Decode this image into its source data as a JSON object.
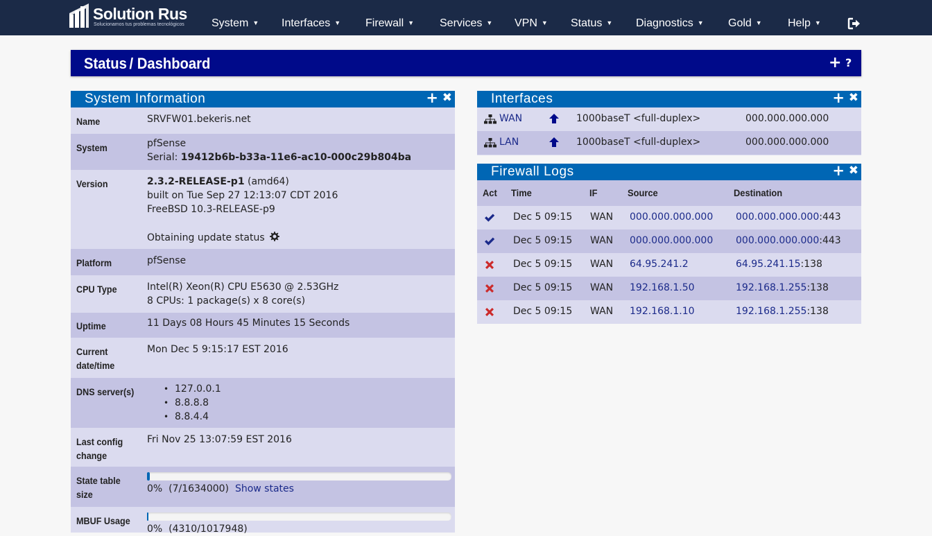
{
  "brand": {
    "name": "Solution Rus",
    "tagline": "Solucionamos tus problemas tecnológicos"
  },
  "nav": {
    "items": [
      "System",
      "Interfaces",
      "Firewall",
      "Services",
      "VPN",
      "Status",
      "Diagnostics",
      "Gold",
      "Help"
    ],
    "logout_icon": "sign-out-icon"
  },
  "header": {
    "section": "Status",
    "separator": "/",
    "page": "Dashboard",
    "add": "+",
    "help": "?"
  },
  "system_info": {
    "title": "System Information",
    "name_label": "Name",
    "name_value": "SRVFW01.bekeris.net",
    "system_label": "System",
    "system_line1": "pfSense",
    "serial_prefix": "Serial: ",
    "serial": "19412b6b-b33a-11e6-ac10-000c29b804ba",
    "version_label": "Version",
    "version": "2.3.2-RELEASE-p1",
    "arch": " (amd64)",
    "built": "built on Tue Sep 27 12:13:07 CDT 2016",
    "freebsd": "FreeBSD 10.3-RELEASE-p9",
    "update_status": "Obtaining update status",
    "platform_label": "Platform",
    "platform": "pfSense",
    "cpu_label": "CPU Type",
    "cpu_line1": "Intel(R) Xeon(R) CPU E5630 @ 2.53GHz",
    "cpu_line2": "8 CPUs: 1 package(s) x 8 core(s)",
    "uptime_label": "Uptime",
    "uptime": "11 Days 08 Hours 45 Minutes 15 Seconds",
    "datetime_label1": "Current",
    "datetime_label2": "date/time",
    "datetime": "Mon Dec 5 9:15:17 EST 2016",
    "dns_label": "DNS server(s)",
    "dns": [
      "127.0.0.1",
      "8.8.8.8",
      "8.8.4.4"
    ],
    "config_label1": "Last config",
    "config_label2": "change",
    "config": "Fri Nov 25 13:07:59 EST 2016",
    "state_label1": "State table",
    "state_label2": "size",
    "state_pct": "0%",
    "state_count": "(7/1634000)",
    "state_fill": 0.01,
    "show_states": "Show states",
    "mbuf_label": "MBUF Usage",
    "mbuf_pct": "0%",
    "mbuf_count": "(4310/1017948)",
    "mbuf_fill": 0.004
  },
  "interfaces": {
    "title": "Interfaces",
    "rows": [
      {
        "name": "WAN",
        "media": "1000baseT <full-duplex>",
        "ip": "000.000.000.000"
      },
      {
        "name": "LAN",
        "media": "1000baseT <full-duplex>",
        "ip": "000.000.000.000"
      }
    ]
  },
  "firewall_logs": {
    "title": "Firewall Logs",
    "columns": {
      "act": "Act",
      "time": "Time",
      "if": "IF",
      "source": "Source",
      "destination": "Destination"
    },
    "rows": [
      {
        "action": "pass",
        "time": "Dec 5 09:15",
        "if": "WAN",
        "source": "000.000.000.000",
        "dest": "000.000.000.000",
        "dest_port": ":443"
      },
      {
        "action": "pass",
        "time": "Dec 5 09:15",
        "if": "WAN",
        "source": "000.000.000.000",
        "dest": "000.000.000.000",
        "dest_port": ":443"
      },
      {
        "action": "block",
        "time": "Dec 5 09:15",
        "if": "WAN",
        "source": "64.95.241.2",
        "dest": "64.95.241.15",
        "dest_port": ":138"
      },
      {
        "action": "block",
        "time": "Dec 5 09:15",
        "if": "WAN",
        "source": "192.168.1.50",
        "dest": "192.168.1.255",
        "dest_port": ":138"
      },
      {
        "action": "block",
        "time": "Dec 5 09:15",
        "if": "WAN",
        "source": "192.168.1.10",
        "dest": "192.168.1.255",
        "dest_port": ":138"
      }
    ]
  },
  "colors": {
    "navbar": "#1b2a47",
    "header": "#000a8a",
    "panel_head": "#0066b4",
    "row": "#dbdbef",
    "row_alt": "#c4c3e3",
    "link": "#1b2a8a",
    "pass": "#1b2a8a",
    "block": "#cc2a2a"
  }
}
